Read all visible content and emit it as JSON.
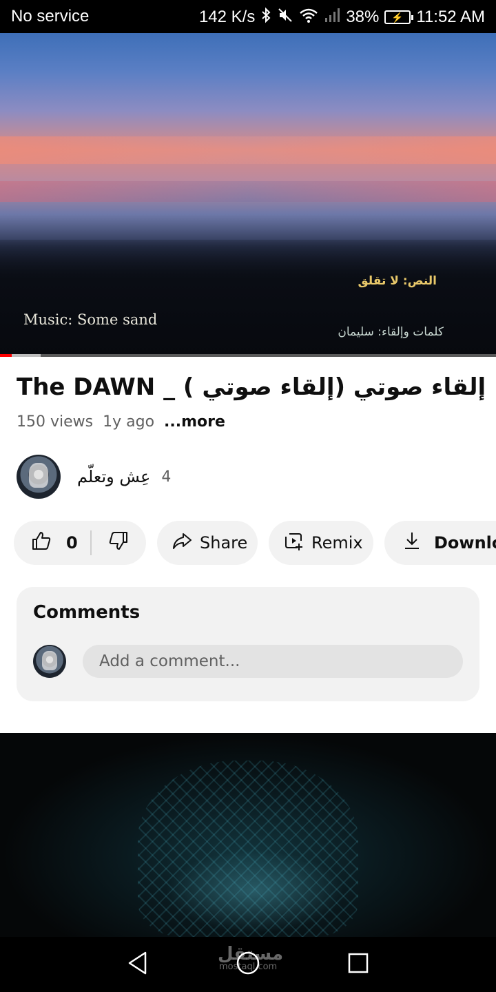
{
  "status_bar": {
    "carrier": "No service",
    "net_speed": "142 K/s",
    "battery": "38%",
    "time": "11:52 AM",
    "icons": [
      "bluetooth-icon",
      "mute-icon",
      "wifi-icon",
      "signal-icon",
      "battery-charging-icon"
    ]
  },
  "player": {
    "overlay_music": "Music: Some sand",
    "overlay_text_credit": "النص: لا تقلق",
    "overlay_lyrics_credit": "كلمات وإلقاء: سليمان",
    "progress_fraction": 0.024,
    "buffer_fraction": 0.082
  },
  "video": {
    "title": "The DAWN _   ( إلقاء صوتي)   إلقاء صوتي",
    "views": "150 views",
    "age": "1y ago",
    "more_label": "...more"
  },
  "channel": {
    "name": "عِش وتعلّم",
    "subscriber_count": "4"
  },
  "actions": {
    "like_count": "0",
    "share_label": "Share",
    "remix_label": "Remix",
    "download_label": "Download"
  },
  "comments": {
    "heading": "Comments",
    "placeholder": "Add a comment..."
  },
  "nav": {
    "watermark": "مستقل",
    "watermark_sub": "mostaql.com"
  },
  "colors": {
    "accent_red": "#ff0000",
    "chip_bg": "#f2f2f2",
    "secondary_text": "#606060"
  }
}
